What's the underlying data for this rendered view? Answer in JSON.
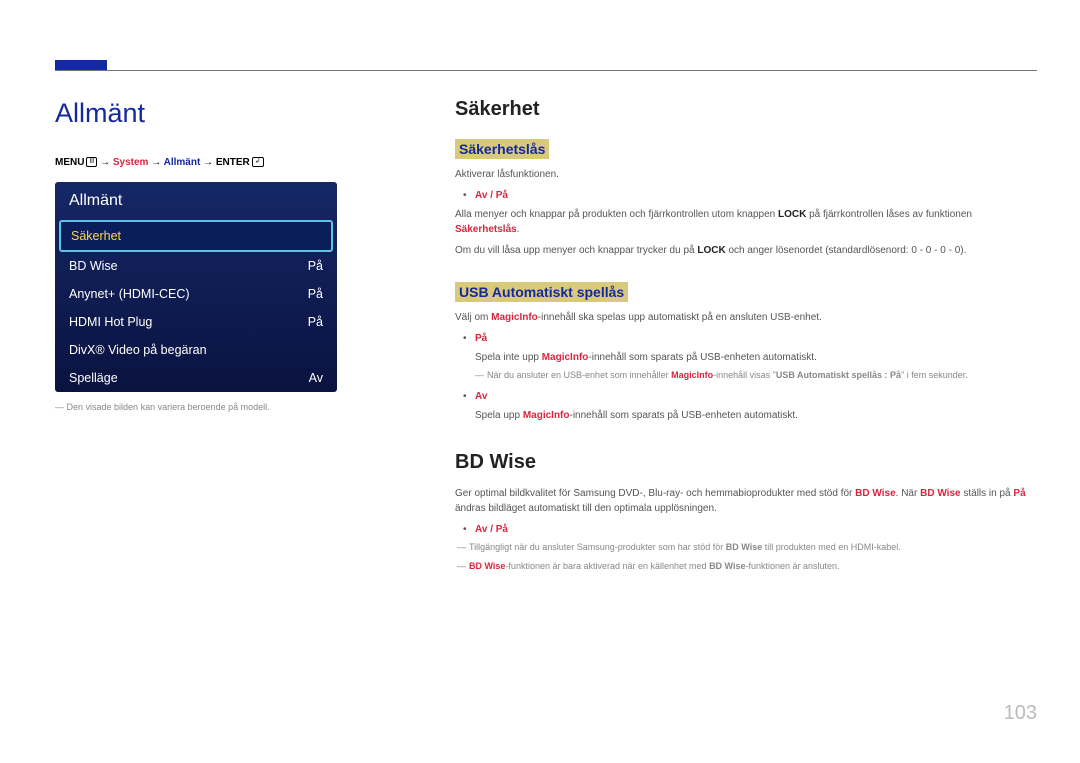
{
  "page_number": "103",
  "left": {
    "title": "Allmänt",
    "breadcrumb": {
      "menu": "MENU",
      "menu_icon": "Ⅲ",
      "sep": " → ",
      "sys": "System",
      "allmant": "Allmänt",
      "enter": "ENTER",
      "enter_icon": "↲"
    },
    "osd": {
      "title": "Allmänt",
      "rows": [
        {
          "label": "Säkerhet",
          "value": ""
        },
        {
          "label": "BD Wise",
          "value": "På"
        },
        {
          "label": "Anynet+ (HDMI-CEC)",
          "value": "På"
        },
        {
          "label": "HDMI Hot Plug",
          "value": "På"
        },
        {
          "label": "DivX® Video på begäran",
          "value": ""
        },
        {
          "label": "Spelläge",
          "value": "Av"
        }
      ]
    },
    "footnote": "Den visade bilden kan variera beroende på modell."
  },
  "right": {
    "section1_title": "Säkerhet",
    "sub1_title": "Säkerhetslås",
    "sub1_p1": "Aktiverar låsfunktionen.",
    "sub1_bullet1": "Av / På",
    "sub1_p2_a": "Alla menyer och knappar på produkten och fjärrkontrollen utom knappen ",
    "sub1_p2_b": " på fjärrkontrollen låses av funktionen ",
    "sub1_p2_lock": "LOCK",
    "sub1_p2_c": "Säkerhetslås",
    "sub1_p2_end": ".",
    "sub1_p3_a": "Om du vill låsa upp menyer och knappar trycker du på ",
    "sub1_p3_lock": "LOCK",
    "sub1_p3_b": " och anger lösenordet (standardlösenord: 0 - 0 - 0 - 0).",
    "sub2_title": "USB Automatiskt spellås",
    "sub2_p1_a": "Välj om ",
    "sub2_p1_mi": "MagicInfo",
    "sub2_p1_b": "-innehåll ska spelas upp automatiskt på en ansluten USB-enhet.",
    "sub2_b1": "På",
    "sub2_b1_sub_a": "Spela inte upp ",
    "sub2_b1_sub_b": "-innehåll som sparats på USB-enheten automatiskt.",
    "sub2_emdash_a": "När du ansluter en USB-enhet som innehåller ",
    "sub2_emdash_b": "-innehåll visas \"",
    "sub2_emdash_c": "USB Automatiskt spellås : På",
    "sub2_emdash_d": "\" i fem sekunder.",
    "sub2_b2": "Av",
    "sub2_b2_sub_a": "Spela upp ",
    "sub2_b2_sub_b": "-innehåll som sparats på USB-enheten automatiskt.",
    "section2_title": "BD Wise",
    "sec2_p1_a": "Ger optimal bildkvalitet för Samsung DVD-, Blu-ray- och hemmabioprodukter med stöd för ",
    "sec2_bdwise": "BD Wise",
    "sec2_p1_b": ". När ",
    "sec2_p1_c": " ställs in på ",
    "sec2_p1_d": " ändras bildläget automatiskt till den optimala upplösningen.",
    "sec2_pa": "På",
    "sec2_bullet": "Av / På",
    "sec2_em1_a": "Tillgängligt när du ansluter Samsung-produkter som har stöd för ",
    "sec2_em1_b": " till produkten med en HDMI-kabel.",
    "sec2_em2_a": "-funktionen är bara aktiverad när en källenhet med ",
    "sec2_em2_b": "-funktionen är ansluten."
  }
}
